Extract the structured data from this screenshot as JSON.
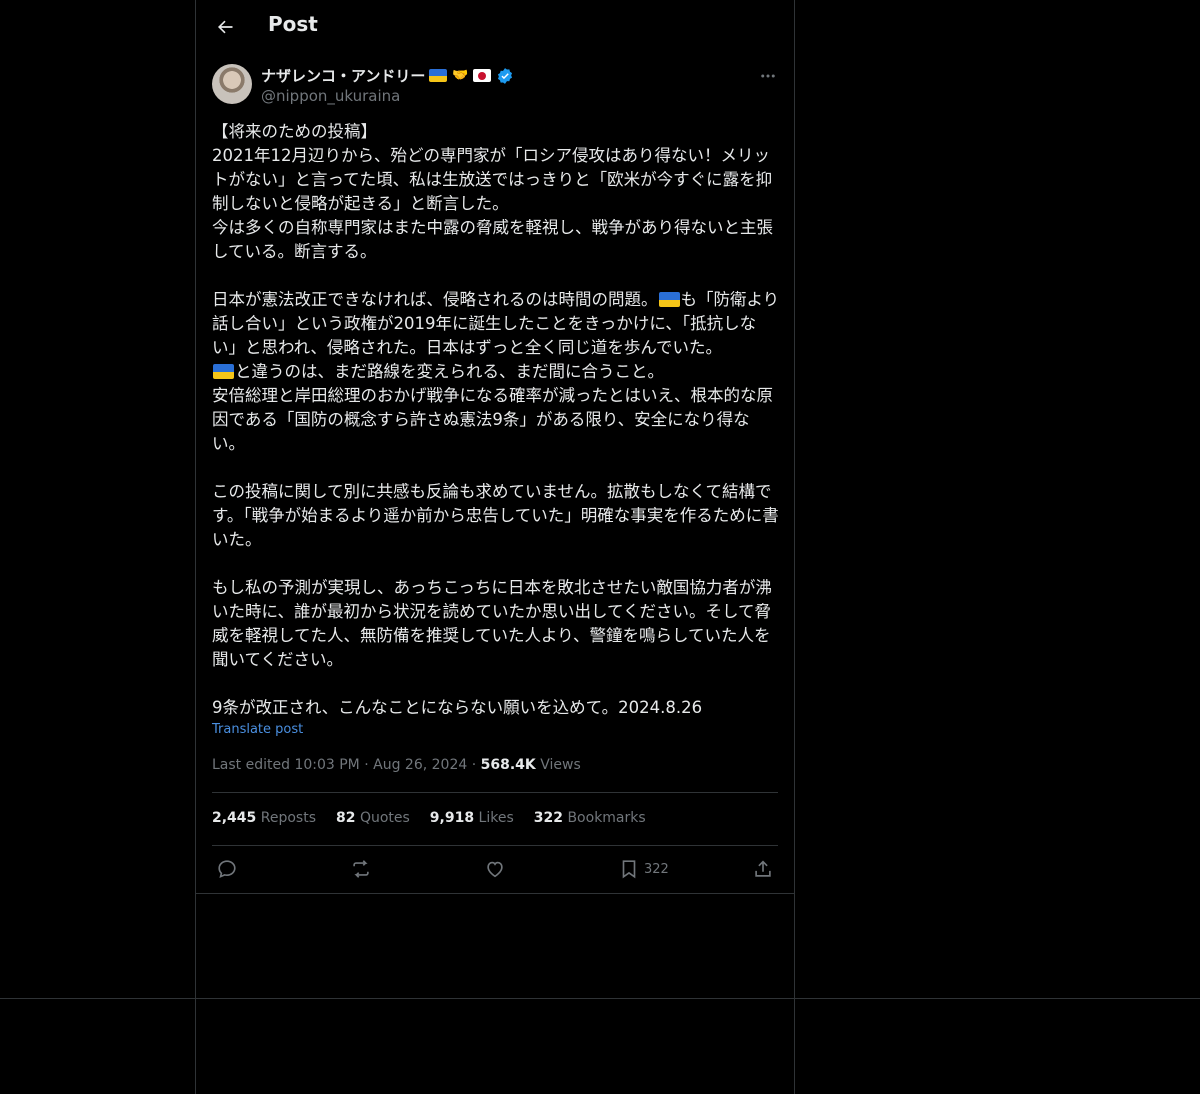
{
  "header": {
    "title": "Post"
  },
  "author": {
    "name": "ナザレンコ・アンドリー",
    "handle": "@nippon_ukuraina"
  },
  "post": {
    "paragraphs": [
      [
        "【将来のための投稿】",
        "2021年12月辺りから、殆どの専門家が「ロシア侵攻はあり得ない！メリットがない」と言ってた頃、私は生放送ではっきりと「欧米が今すぐに露を抑制しないと侵略が起きる」と断言した。",
        "今は多くの自称専門家はまた中露の脅威を軽視し、戦争があり得ないと主張している。断言する。"
      ],
      [
        "日本が憲法改正できなければ、侵略されるのは時間の問題。"
      ],
      [
        "この投稿に関して別に共感も反論も求めていません。拡散もしなくて結構です。「戦争が始まるより遥か前から忠告していた」明確な事実を作るために書いた。"
      ],
      [
        "もし私の予測が実現し、あっちこっちに日本を敗北させたい敵国協力者が沸いた時に、誰が最初から状況を読めていたか思い出してください。そして脅威を軽視してた人、無防備を推奨していた人より、警鐘を鳴らしていた人を聞いてください。"
      ],
      [
        "9条が改正され、こんなことにならない願いを込めて。2024.8.26"
      ]
    ],
    "p2_after_flag": "も「防衛より話し合い」という政権が2019年に誕生したことをきっかけに、「抵抗しない」と思われ、侵略された。日本はずっと全く同じ道を歩んでいた。",
    "p2_after_flag2": "と違うのは、まだ路線を変えられる、まだ間に合うこと。",
    "p2_tail": "安倍総理と岸田総理のおかげ戦争になる確率が減ったとはいえ、根本的な原因である「国防の概念すら許さぬ憲法9条」がある限り、安全になり得ない。",
    "translate_label": "Translate post"
  },
  "meta": {
    "edited": "Last edited 10:03 PM",
    "sep1": "·",
    "date": "Aug 26, 2024",
    "sep2": "·",
    "views_count": "568.4K",
    "views_label": "Views"
  },
  "stats": {
    "reposts_count": "2,445",
    "reposts_label": "Reposts",
    "quotes_count": "82",
    "quotes_label": "Quotes",
    "likes_count": "9,918",
    "likes_label": "Likes",
    "bookmarks_count": "322",
    "bookmarks_label": "Bookmarks"
  },
  "actions": {
    "bookmark_count": "322"
  },
  "icons": {
    "back": "arrow-left-icon",
    "more": "more-horizontal-icon",
    "verified": "verified-badge-icon",
    "reply": "reply-icon",
    "repost": "repost-icon",
    "like": "heart-icon",
    "bookmark": "bookmark-icon",
    "share": "share-icon"
  },
  "colors": {
    "background": "#000000",
    "text": "#e7e9ea",
    "muted": "#71767b",
    "border": "#2f3336",
    "link": "#4a8fe0",
    "verified": "#1d9bf0"
  }
}
